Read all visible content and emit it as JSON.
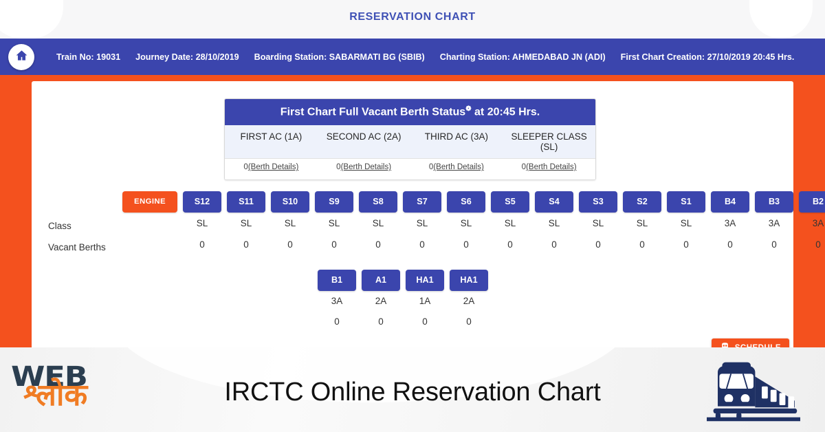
{
  "header": {
    "title": "RESERVATION CHART",
    "home_icon": "home-icon"
  },
  "info_bar": {
    "train_no": "Train No: 19031",
    "journey_date": "Journey Date: 28/10/2019",
    "boarding_station": "Boarding Station: SABARMATI BG (SBIB)",
    "charting_station": "Charting Station: AHMEDABAD JN (ADI)",
    "first_chart_creation": "First Chart Creation: 27/10/2019 20:45 Hrs."
  },
  "vacant_card": {
    "title_prefix": "First Chart Full Vacant Berth Status",
    "title_star": "❁",
    "title_suffix": " at 20:45 Hrs.",
    "classes": [
      "FIRST AC (1A)",
      "SECOND AC (2A)",
      "THIRD AC (3A)",
      "SLEEPER CLASS (SL)"
    ],
    "counts": [
      "0",
      "0",
      "0",
      "0"
    ],
    "link_label": "(Berth Details)"
  },
  "coach_table": {
    "label_class": "Class",
    "label_vacant": "Vacant Berths",
    "engine_label": "ENGINE",
    "row1": [
      {
        "coach": "S12",
        "class": "SL",
        "vacant": "0"
      },
      {
        "coach": "S11",
        "class": "SL",
        "vacant": "0"
      },
      {
        "coach": "S10",
        "class": "SL",
        "vacant": "0"
      },
      {
        "coach": "S9",
        "class": "SL",
        "vacant": "0"
      },
      {
        "coach": "S8",
        "class": "SL",
        "vacant": "0"
      },
      {
        "coach": "S7",
        "class": "SL",
        "vacant": "0"
      },
      {
        "coach": "S6",
        "class": "SL",
        "vacant": "0"
      },
      {
        "coach": "S5",
        "class": "SL",
        "vacant": "0"
      },
      {
        "coach": "S4",
        "class": "SL",
        "vacant": "0"
      },
      {
        "coach": "S3",
        "class": "SL",
        "vacant": "0"
      },
      {
        "coach": "S2",
        "class": "SL",
        "vacant": "0"
      },
      {
        "coach": "S1",
        "class": "SL",
        "vacant": "0"
      },
      {
        "coach": "B4",
        "class": "3A",
        "vacant": "0"
      },
      {
        "coach": "B3",
        "class": "3A",
        "vacant": "0"
      },
      {
        "coach": "B2",
        "class": "3A",
        "vacant": "0"
      }
    ],
    "row2": [
      {
        "coach": "B1",
        "class": "3A",
        "vacant": "0"
      },
      {
        "coach": "A1",
        "class": "2A",
        "vacant": "0"
      },
      {
        "coach": "HA1",
        "class": "1A",
        "vacant": "0"
      },
      {
        "coach": "HA1",
        "class": "2A",
        "vacant": "0"
      }
    ]
  },
  "schedule_button": {
    "label": "SCHEDULE",
    "icon": "train-icon"
  },
  "banner": {
    "logo_web": "WEB",
    "logo_shlok": "श्लोक",
    "title": "IRCTC Online Reservation Chart",
    "train_icon": "train-front-icon"
  },
  "colors": {
    "primary_blue": "#3b45ad",
    "accent_orange": "#f4511e",
    "logo_orange": "#f07c24",
    "logo_navy": "#2b3e50",
    "title_blue": "#3f51b5"
  }
}
